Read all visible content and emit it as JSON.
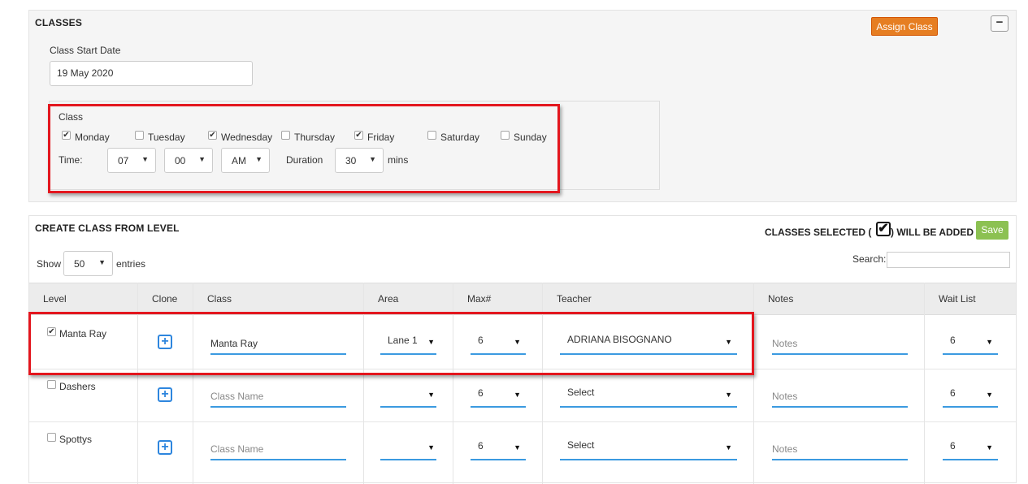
{
  "classes_panel": {
    "title": "CLASSES",
    "assign_button": "Assign Class",
    "collapse_label": "−",
    "start_date_label": "Class Start Date",
    "start_date_value": "19 May 2020",
    "class_label": "Class",
    "days": [
      {
        "label": "Monday",
        "checked": "✔"
      },
      {
        "label": "Tuesday",
        "checked": ""
      },
      {
        "label": "Wednesday",
        "checked": "✔"
      },
      {
        "label": "Thursday",
        "checked": ""
      },
      {
        "label": "Friday",
        "checked": "✔"
      },
      {
        "label": "Saturday",
        "checked": ""
      },
      {
        "label": "Sunday",
        "checked": ""
      }
    ],
    "time_label": "Time:",
    "hour": "07",
    "minute": "00",
    "ampm": "AM",
    "duration_label": "Duration",
    "duration": "30",
    "mins_label": "mins"
  },
  "level_panel": {
    "title": "CREATE CLASS FROM LEVEL",
    "selected_text_before": "CLASSES SELECTED (",
    "selected_text_after": ") WILL BE ADDED",
    "save_button": "Save",
    "show_label": "Show",
    "entries_value": "50",
    "entries_label": "entries",
    "search_label": "Search:",
    "columns": [
      "Level",
      "Clone",
      "Class",
      "Area",
      "Max#",
      "Teacher",
      "Notes",
      "Wait List"
    ],
    "rows": [
      {
        "checked": "✔",
        "level": "Manta Ray",
        "class_value": "Manta Ray",
        "area": "Lane 1",
        "max": "6",
        "teacher": "ADRIANA BISOGNANO",
        "notes_placeholder": "Notes",
        "wait": "6"
      },
      {
        "checked": "",
        "level": "Dashers",
        "class_value": "Class Name",
        "area": "",
        "max": "6",
        "teacher": "Select",
        "notes_placeholder": "Notes",
        "wait": "6"
      },
      {
        "checked": "",
        "level": "Spottys",
        "class_value": "Class Name",
        "area": "",
        "max": "6",
        "teacher": "Select",
        "notes_placeholder": "Notes",
        "wait": "6"
      }
    ]
  },
  "icons": {
    "dropdown": "▼",
    "plus": "+",
    "check": "✔"
  }
}
